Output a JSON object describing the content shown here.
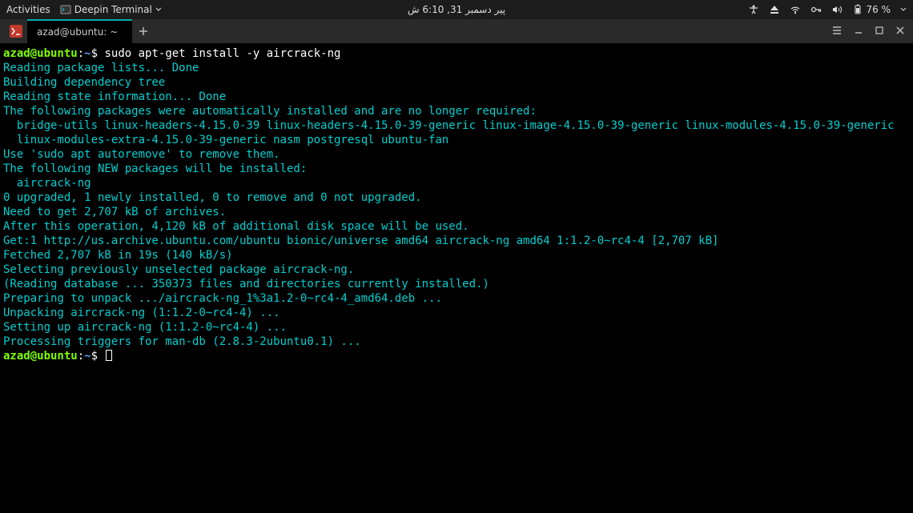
{
  "topbar": {
    "activities": "Activities",
    "app_name": "Deepin Terminal",
    "clock": "پیر دسمبر 31, 6:10 ش",
    "battery": "76 %"
  },
  "tabbar": {
    "tab_title": "azad@ubuntu: ~"
  },
  "terminal": {
    "prompt_user": "azad@ubuntu",
    "prompt_colon": ":",
    "prompt_path": "~",
    "prompt_dollar": "$",
    "cmd1": " sudo apt-get install -y aircrack-ng",
    "out": [
      "Reading package lists... Done",
      "Building dependency tree       ",
      "Reading state information... Done",
      "The following packages were automatically installed and are no longer required:",
      "  bridge-utils linux-headers-4.15.0-39 linux-headers-4.15.0-39-generic linux-image-4.15.0-39-generic linux-modules-4.15.0-39-generic",
      "  linux-modules-extra-4.15.0-39-generic nasm postgresql ubuntu-fan",
      "Use 'sudo apt autoremove' to remove them.",
      "The following NEW packages will be installed:",
      "  aircrack-ng",
      "0 upgraded, 1 newly installed, 0 to remove and 0 not upgraded.",
      "Need to get 2,707 kB of archives.",
      "After this operation, 4,120 kB of additional disk space will be used.",
      "Get:1 http://us.archive.ubuntu.com/ubuntu bionic/universe amd64 aircrack-ng amd64 1:1.2-0~rc4-4 [2,707 kB]",
      "Fetched 2,707 kB in 19s (140 kB/s)                                                                                                    ",
      "Selecting previously unselected package aircrack-ng.",
      "(Reading database ... 350373 files and directories currently installed.)",
      "Preparing to unpack .../aircrack-ng_1%3a1.2-0~rc4-4_amd64.deb ...",
      "Unpacking aircrack-ng (1:1.2-0~rc4-4) ...",
      "Setting up aircrack-ng (1:1.2-0~rc4-4) ...",
      "Processing triggers for man-db (2.8.3-2ubuntu0.1) ..."
    ]
  }
}
